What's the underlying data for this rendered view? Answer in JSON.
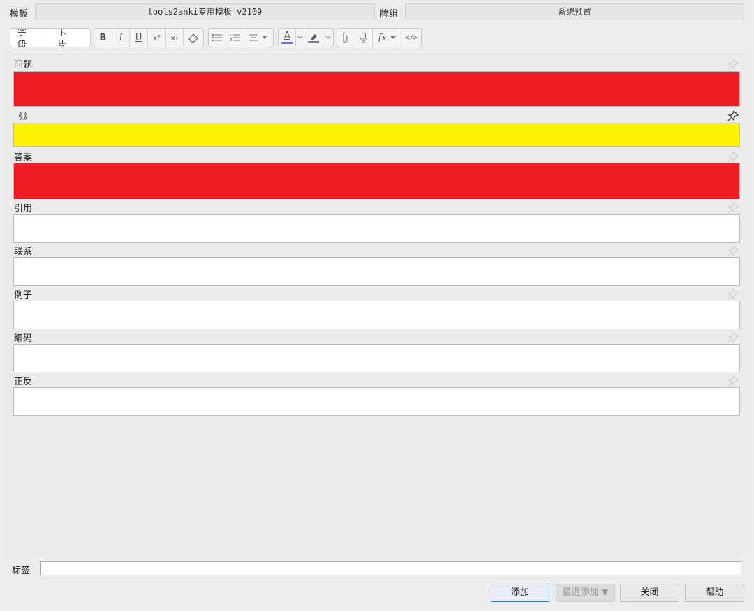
{
  "window": {
    "notetype_label": "模板",
    "notetype_value": "tools2anki专用模板 v2109",
    "deck_label": "牌组",
    "deck_value": "系统预置"
  },
  "toolbar": {
    "fields_button": "字段...",
    "cards_button": "卡片...",
    "bold": "B",
    "italic": "I",
    "underline": "U",
    "superscript": "x²",
    "subscript": "x₂",
    "font_color_icon": "A",
    "mathjax_icon": "fx",
    "html_icon": "</>"
  },
  "fields": [
    {
      "name": "问题",
      "fill": "#ee1c25",
      "pinned": false
    },
    {
      "name": "《》",
      "fill": "#fff200",
      "pinned": true
    },
    {
      "name": "答案",
      "fill": "#ee1c25",
      "pinned": false
    },
    {
      "name": "引用",
      "fill": "#ffffff",
      "pinned": false
    },
    {
      "name": "联系",
      "fill": "#ffffff",
      "pinned": false
    },
    {
      "name": "例子",
      "fill": "#ffffff",
      "pinned": false
    },
    {
      "name": "编码",
      "fill": "#ffffff",
      "pinned": false
    },
    {
      "name": "正反",
      "fill": "#ffffff",
      "pinned": false
    }
  ],
  "tags": {
    "label": "标签",
    "value": ""
  },
  "buttons": {
    "add": "添加",
    "history": "最近添加 ▼",
    "close": "关闭",
    "help": "帮助"
  },
  "colors": {
    "font_color_bar": "#6f6fd8",
    "highlight_bar": "#6f6fd8",
    "add_button_border": "#3a78c8"
  }
}
